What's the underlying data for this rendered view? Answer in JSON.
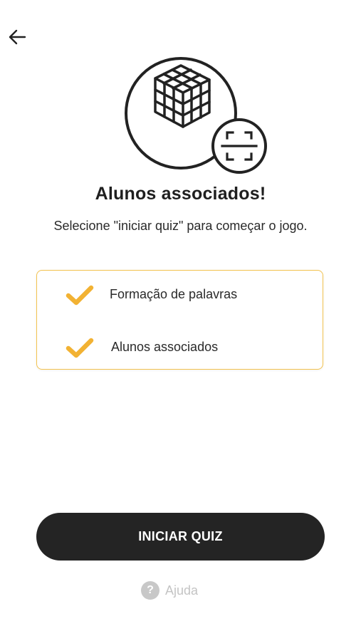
{
  "colors": {
    "accent": "#f2b233",
    "border_accent": "#f2c24f",
    "button_bg": "#242424",
    "button_text": "#ffffff",
    "muted": "#c4c4c4"
  },
  "header": {
    "back_icon": "arrow-left-icon"
  },
  "hero": {
    "main_icon": "rubiks-cube-icon",
    "badge_icon": "qr-scan-icon"
  },
  "title": "Alunos associados!",
  "subtitle": "Selecione \"iniciar quiz\" para começar o jogo.",
  "checklist": {
    "items": [
      {
        "icon": "checkmark-icon",
        "label": "Formação de palavras"
      },
      {
        "icon": "checkmark-icon",
        "label": "Alunos associados"
      }
    ]
  },
  "actions": {
    "start_label": "INICIAR QUIZ",
    "help_icon": "help-circle-icon",
    "help_glyph": "?",
    "help_label": "Ajuda"
  }
}
